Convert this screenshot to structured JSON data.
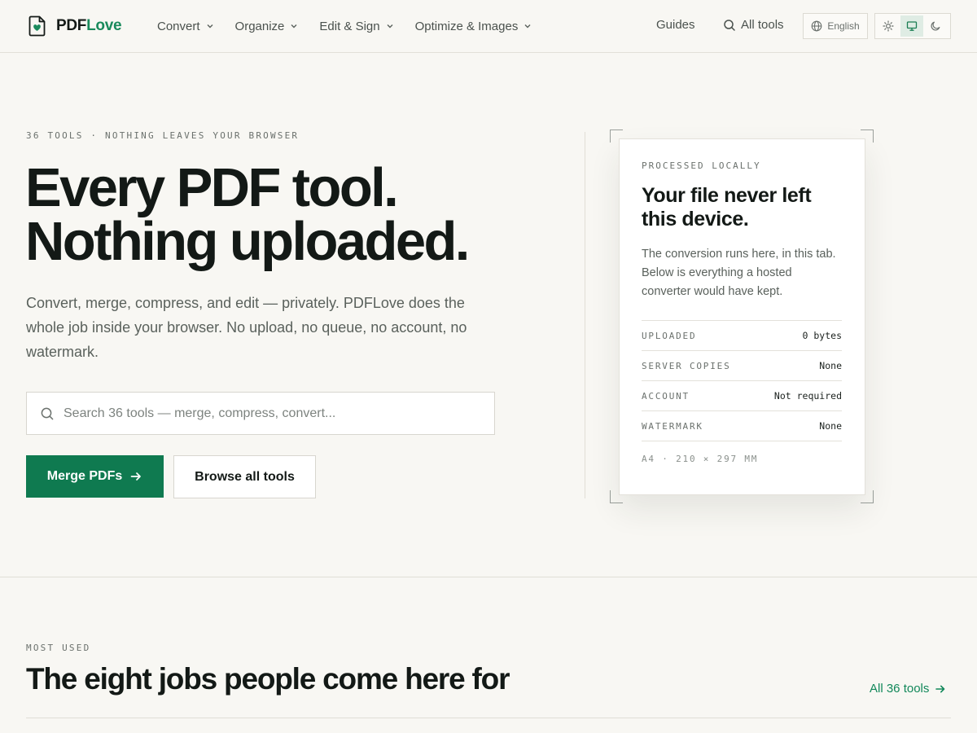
{
  "header": {
    "logo_part1": "PDF",
    "logo_part2": "Love",
    "nav": [
      {
        "label": "Convert"
      },
      {
        "label": "Organize"
      },
      {
        "label": "Edit & Sign"
      },
      {
        "label": "Optimize & Images"
      }
    ],
    "guides_label": "Guides",
    "all_tools_label": "All tools",
    "language": "English",
    "theme_modes": [
      "light",
      "system",
      "dark"
    ],
    "theme_selected": "system"
  },
  "hero": {
    "eyebrow": "36 TOOLS · NOTHING LEAVES YOUR BROWSER",
    "title_line1": "Every PDF tool.",
    "title_line2": "Nothing uploaded.",
    "subtitle": "Convert, merge, compress, and edit — privately. PDFLove does the whole job inside your browser. No upload, no queue, no account, no watermark.",
    "search_placeholder": "Search 36 tools — merge, compress, convert...",
    "primary_button": "Merge PDFs",
    "secondary_button": "Browse all tools"
  },
  "card": {
    "eyebrow": "PROCESSED LOCALLY",
    "title": "Your file never left this device.",
    "body": "The conversion runs here, in this tab. Below is everything a hosted converter would have kept.",
    "rows": [
      {
        "key": "UPLOADED",
        "value": "0 bytes"
      },
      {
        "key": "SERVER COPIES",
        "value": "None"
      },
      {
        "key": "ACCOUNT",
        "value": "Not required"
      },
      {
        "key": "WATERMARK",
        "value": "None"
      }
    ],
    "footer": "A4 · 210 × 297 MM"
  },
  "section": {
    "eyebrow": "MOST USED",
    "title": "The eight jobs people come here for",
    "link": "All 36 tools"
  },
  "colors": {
    "accent": "#0f7a50",
    "accent_text": "#1a8a5c",
    "background": "#f8f7f3",
    "ink": "#131916"
  }
}
